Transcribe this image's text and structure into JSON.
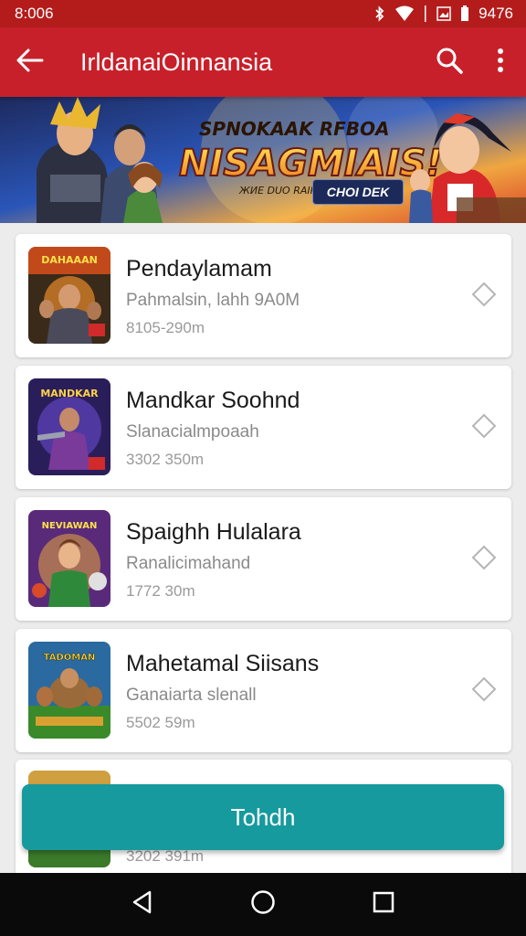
{
  "status_bar": {
    "time": "8:006",
    "battery_text": "9476",
    "icons": [
      "bluetooth-icon",
      "wifi-icon",
      "image-icon",
      "battery-icon"
    ]
  },
  "app_bar": {
    "title": "IrldanaiOinnansia",
    "back_icon": "arrow-left-icon",
    "search_icon": "search-icon",
    "more_icon": "more-vertical-icon",
    "color": "#c8202a"
  },
  "banner": {
    "headline_top": "SPNOKAAK RFBOA",
    "headline_main": "NISAGMIAIS!",
    "tagline": "ЖИЕ DUO RAIRAS",
    "cta": "CHOI DEK"
  },
  "games": [
    {
      "title": "Pendaylamam",
      "subtitle": "Pahmalsin, lahh 9A0M",
      "meta": "8105-290m",
      "thumb_text": "DAHAAAN",
      "action_icon": "diamond-outline-icon"
    },
    {
      "title": "Mandkar Soohnd",
      "subtitle": "Slanacialmpoaah",
      "meta": "3302 350m",
      "thumb_text": "MANDKAR",
      "action_icon": "diamond-outline-icon"
    },
    {
      "title": "Spaighh Hulalara",
      "subtitle": "Ranalicimahand",
      "meta": "1772 30m",
      "thumb_text": "NEVIAWAN",
      "action_icon": "diamond-outline-icon"
    },
    {
      "title": "Mahetamal Siisans",
      "subtitle": "Ganaiarta slenall",
      "meta": "5502 59m",
      "thumb_text": "TADOMAN",
      "action_icon": "diamond-outline-icon"
    }
  ],
  "peek_item": {
    "meta": "3202 391m"
  },
  "primary_button": {
    "label": "Tohdh",
    "color": "#169a9e"
  },
  "nav_bar": {
    "back_icon": "nav-back-icon",
    "home_icon": "nav-home-icon",
    "recents_icon": "nav-recents-icon"
  }
}
